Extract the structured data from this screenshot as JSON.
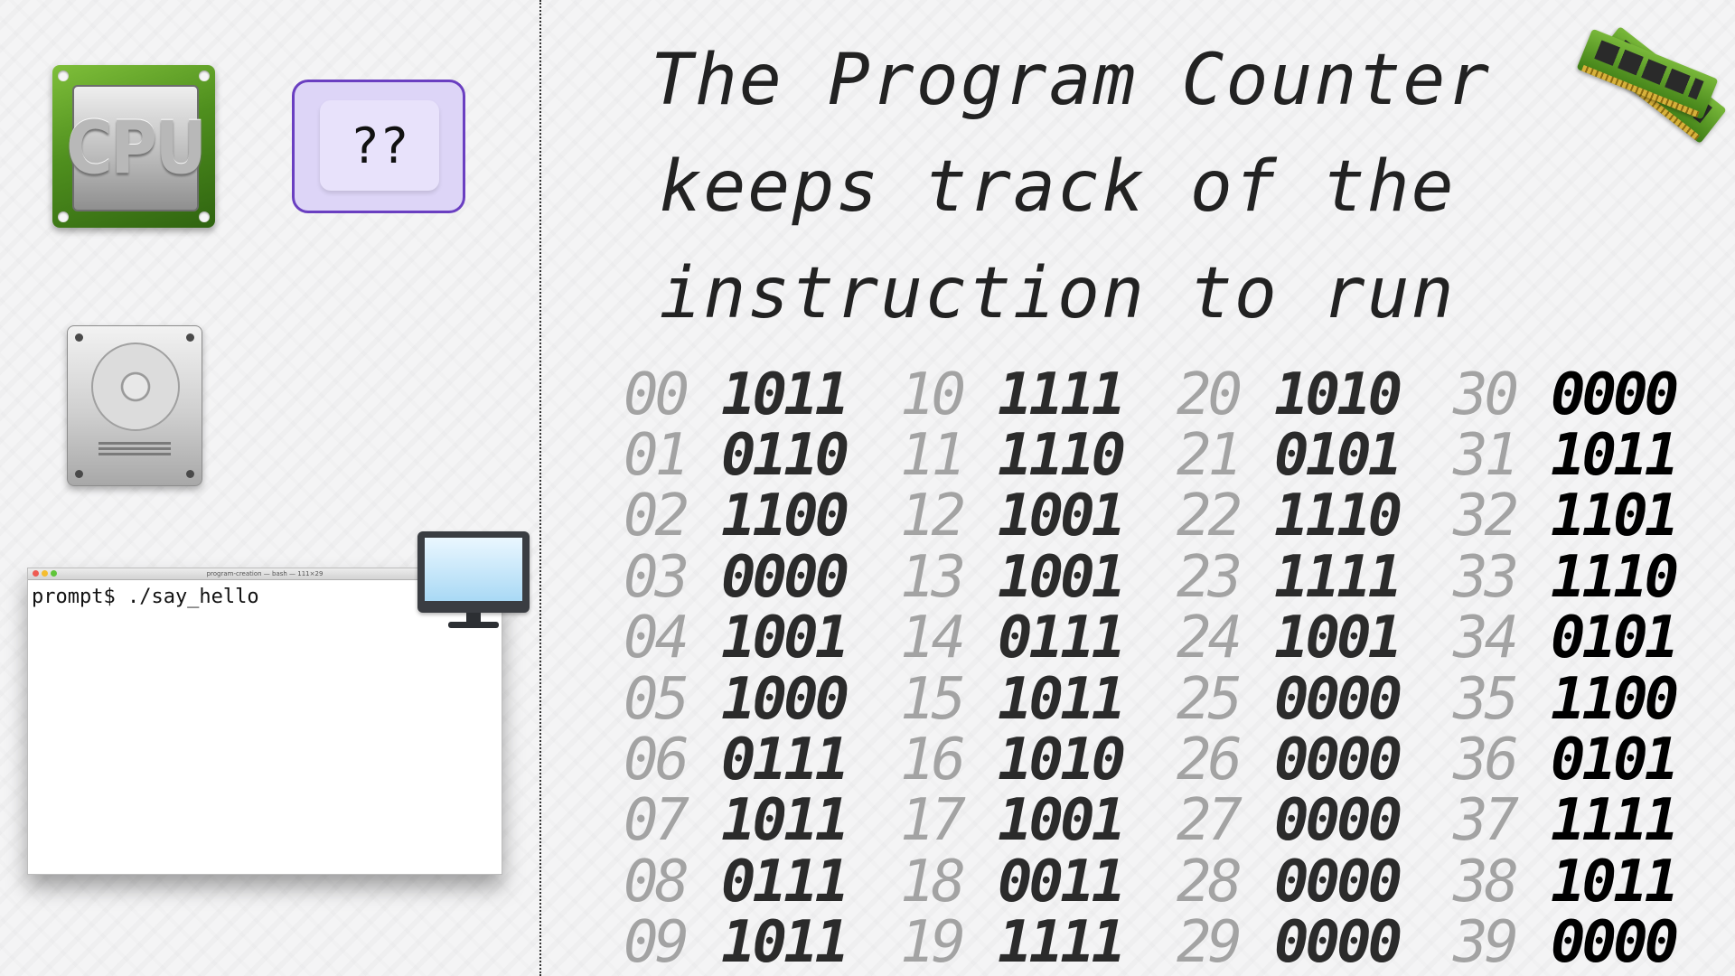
{
  "title": {
    "line1": "The Program Counter",
    "line2": "keeps track of the",
    "line3": "instruction to run"
  },
  "components": {
    "cpu_label": "CPU",
    "unknown_label": "??",
    "colors": {
      "cpu_green": "#4f8f1e",
      "unknown_border": "#6a3fc1",
      "unknown_fill": "#ddd5f7"
    }
  },
  "terminal": {
    "title": "program-creation — bash — 111×29",
    "prompt_line": "prompt$ ./say_hello"
  },
  "memory": {
    "columns": [
      [
        {
          "addr": "00",
          "value": "1011"
        },
        {
          "addr": "01",
          "value": "0110"
        },
        {
          "addr": "02",
          "value": "1100"
        },
        {
          "addr": "03",
          "value": "0000"
        },
        {
          "addr": "04",
          "value": "1001"
        },
        {
          "addr": "05",
          "value": "1000"
        },
        {
          "addr": "06",
          "value": "0111"
        },
        {
          "addr": "07",
          "value": "1011"
        },
        {
          "addr": "08",
          "value": "0111"
        },
        {
          "addr": "09",
          "value": "1011"
        }
      ],
      [
        {
          "addr": "10",
          "value": "1111"
        },
        {
          "addr": "11",
          "value": "1110"
        },
        {
          "addr": "12",
          "value": "1001"
        },
        {
          "addr": "13",
          "value": "1001"
        },
        {
          "addr": "14",
          "value": "0111"
        },
        {
          "addr": "15",
          "value": "1011"
        },
        {
          "addr": "16",
          "value": "1010"
        },
        {
          "addr": "17",
          "value": "1001"
        },
        {
          "addr": "18",
          "value": "0011"
        },
        {
          "addr": "19",
          "value": "1111"
        }
      ],
      [
        {
          "addr": "20",
          "value": "1010"
        },
        {
          "addr": "21",
          "value": "0101"
        },
        {
          "addr": "22",
          "value": "1110"
        },
        {
          "addr": "23",
          "value": "1111"
        },
        {
          "addr": "24",
          "value": "1001"
        },
        {
          "addr": "25",
          "value": "0000"
        },
        {
          "addr": "26",
          "value": "0000"
        },
        {
          "addr": "27",
          "value": "0000"
        },
        {
          "addr": "28",
          "value": "0000"
        },
        {
          "addr": "29",
          "value": "0000"
        }
      ],
      [
        {
          "addr": "30",
          "value": "0000"
        },
        {
          "addr": "31",
          "value": "1011"
        },
        {
          "addr": "32",
          "value": "1101"
        },
        {
          "addr": "33",
          "value": "1110"
        },
        {
          "addr": "34",
          "value": "0101"
        },
        {
          "addr": "35",
          "value": "1100"
        },
        {
          "addr": "36",
          "value": "0101"
        },
        {
          "addr": "37",
          "value": "1111"
        },
        {
          "addr": "38",
          "value": "1011"
        },
        {
          "addr": "39",
          "value": "0000"
        }
      ]
    ]
  }
}
